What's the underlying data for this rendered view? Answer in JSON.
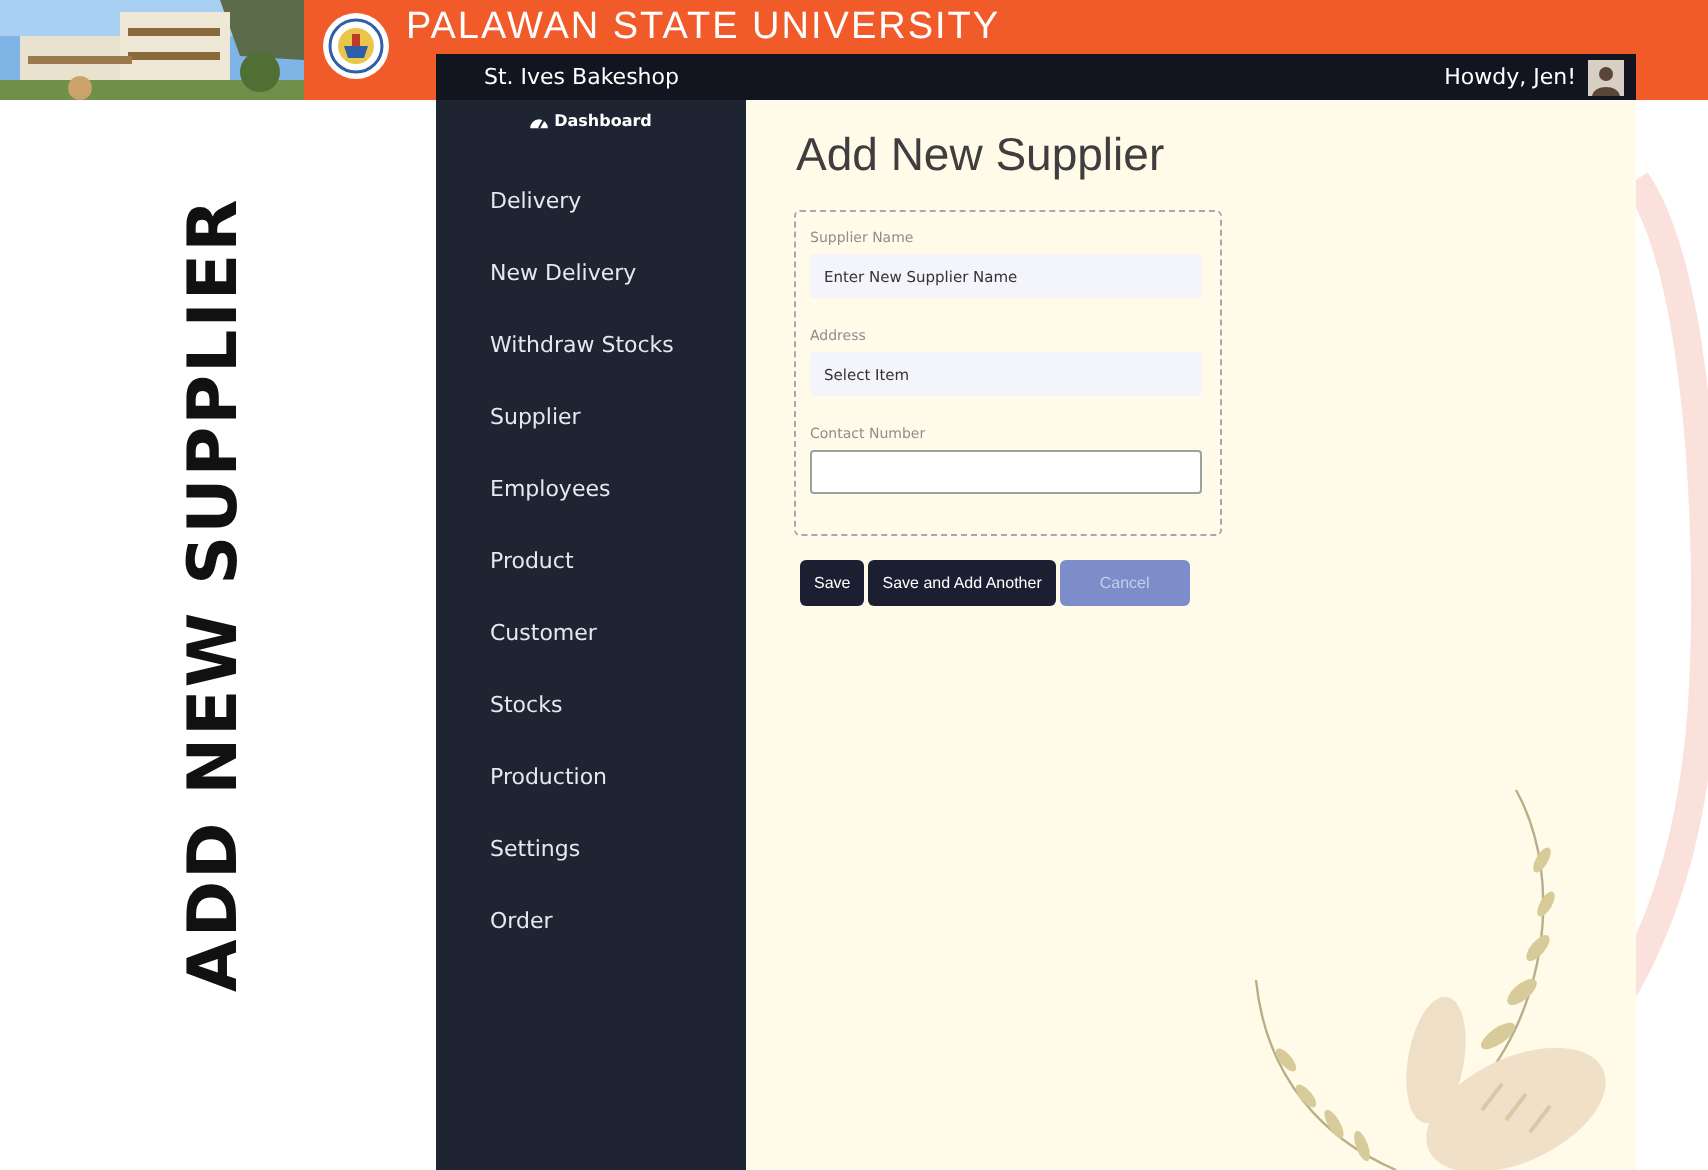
{
  "slide": {
    "banner_title": "PALAWAN STATE UNIVERSITY",
    "side_title": "ADD NEW SUPPLIER"
  },
  "app": {
    "brand": "St. Ives Bakeshop",
    "greeting": "Howdy, Jen!"
  },
  "sidebar": {
    "dashboard": "Dashboard",
    "items": [
      {
        "label": "Delivery"
      },
      {
        "label": "New Delivery"
      },
      {
        "label": "Withdraw Stocks"
      },
      {
        "label": "Supplier"
      },
      {
        "label": "Employees"
      },
      {
        "label": "Product"
      },
      {
        "label": "Customer"
      },
      {
        "label": "Stocks"
      },
      {
        "label": "Production"
      },
      {
        "label": "Settings"
      },
      {
        "label": "Order"
      }
    ]
  },
  "form": {
    "title": "Add New Supplier",
    "fields": [
      {
        "label": "Supplier Name",
        "kind": "input",
        "placeholder": "Enter New Supplier Name",
        "focused": false
      },
      {
        "label": "Address",
        "kind": "select",
        "value": "Select Item",
        "focused": false
      },
      {
        "label": "Contact Number",
        "kind": "input",
        "focused": true
      }
    ],
    "buttons": [
      {
        "label": "Save",
        "kind": "dark"
      },
      {
        "label": "Save and Add Another",
        "kind": "dark"
      },
      {
        "label": "Cancel",
        "kind": "muted"
      }
    ]
  }
}
